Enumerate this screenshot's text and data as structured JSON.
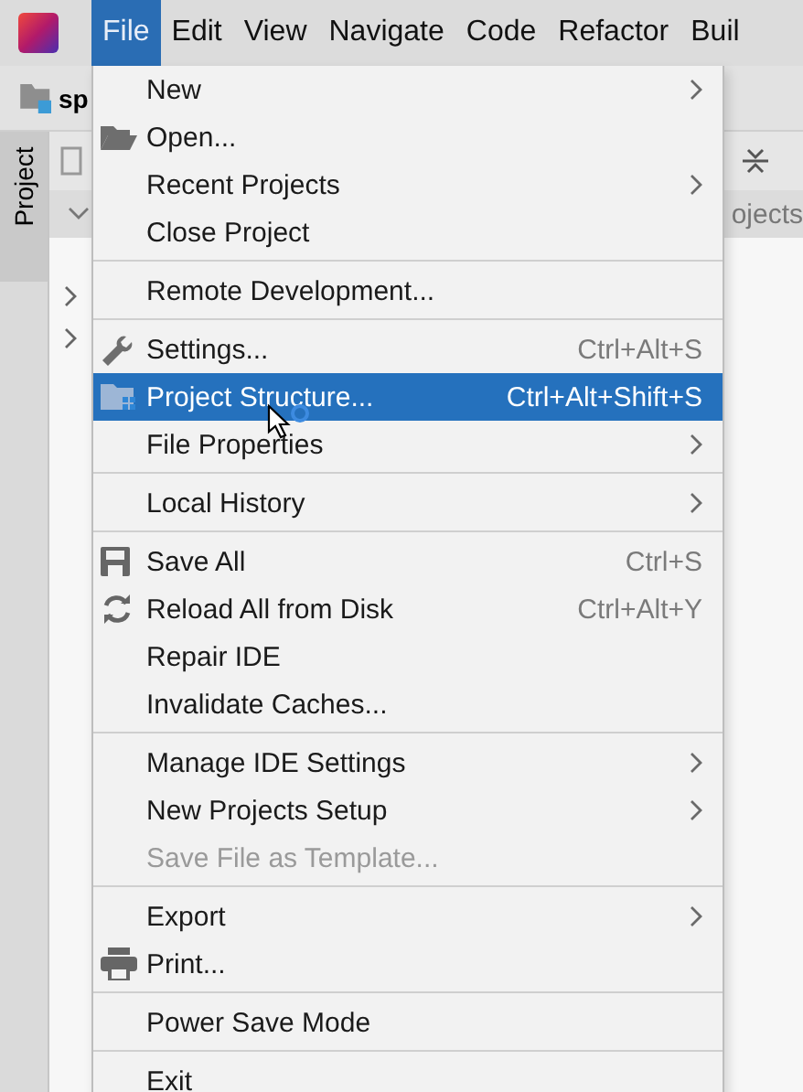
{
  "menubar": {
    "items": [
      {
        "label": "File",
        "selected": true
      },
      {
        "label": "Edit",
        "selected": false
      },
      {
        "label": "View",
        "selected": false
      },
      {
        "label": "Navigate",
        "selected": false
      },
      {
        "label": "Code",
        "selected": false
      },
      {
        "label": "Refactor",
        "selected": false
      },
      {
        "label": "Buil",
        "selected": false
      }
    ]
  },
  "navigation_bar": {
    "project_name": "sp"
  },
  "tool_window": {
    "tab": "Project",
    "header_text": "ojects"
  },
  "file_menu": {
    "sections": [
      {
        "items": [
          {
            "label": "New",
            "submenu": true,
            "selected": false,
            "disabled": false
          },
          {
            "label": "Open...",
            "submenu": false,
            "selected": false,
            "disabled": false
          },
          {
            "label": "Recent Projects",
            "submenu": true,
            "selected": false,
            "disabled": false
          },
          {
            "label": "Close Project",
            "submenu": false,
            "selected": false,
            "disabled": false
          }
        ]
      },
      {
        "items": [
          {
            "label": "Remote Development...",
            "submenu": false,
            "selected": false,
            "disabled": false
          }
        ]
      },
      {
        "items": [
          {
            "label": "Settings...",
            "shortcut": "Ctrl+Alt+S",
            "submenu": false,
            "selected": false,
            "disabled": false
          },
          {
            "label": "Project Structure...",
            "shortcut": "Ctrl+Alt+Shift+S",
            "submenu": false,
            "selected": true,
            "disabled": false
          },
          {
            "label": "File Properties",
            "submenu": true,
            "selected": false,
            "disabled": false
          }
        ]
      },
      {
        "items": [
          {
            "label": "Local History",
            "submenu": true,
            "selected": false,
            "disabled": false
          }
        ]
      },
      {
        "items": [
          {
            "label": "Save All",
            "shortcut": "Ctrl+S",
            "submenu": false,
            "selected": false,
            "disabled": false
          },
          {
            "label": "Reload All from Disk",
            "shortcut": "Ctrl+Alt+Y",
            "submenu": false,
            "selected": false,
            "disabled": false
          },
          {
            "label": "Repair IDE",
            "submenu": false,
            "selected": false,
            "disabled": false
          },
          {
            "label": "Invalidate Caches...",
            "submenu": false,
            "selected": false,
            "disabled": false
          }
        ]
      },
      {
        "items": [
          {
            "label": "Manage IDE Settings",
            "submenu": true,
            "selected": false,
            "disabled": false
          },
          {
            "label": "New Projects Setup",
            "submenu": true,
            "selected": false,
            "disabled": false
          },
          {
            "label": "Save File as Template...",
            "submenu": false,
            "selected": false,
            "disabled": true
          }
        ]
      },
      {
        "items": [
          {
            "label": "Export",
            "submenu": true,
            "selected": false,
            "disabled": false
          },
          {
            "label": "Print...",
            "submenu": false,
            "selected": false,
            "disabled": false
          }
        ]
      },
      {
        "items": [
          {
            "label": "Power Save Mode",
            "submenu": false,
            "selected": false,
            "disabled": false
          }
        ]
      },
      {
        "items": [
          {
            "label": "Exit",
            "submenu": false,
            "selected": false,
            "disabled": false
          }
        ]
      }
    ]
  }
}
